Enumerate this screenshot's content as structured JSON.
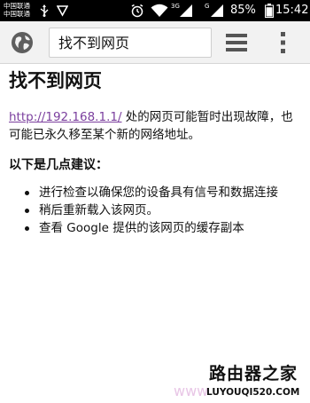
{
  "status_bar": {
    "carrier_1": "中国联通",
    "carrier_2": "中国联通",
    "network_label_1": "3G",
    "network_label_2": "G",
    "battery": "85%",
    "time": "15:42",
    "icons": [
      "usb-icon",
      "download-icon",
      "alarm-icon",
      "wifi-icon",
      "signal-icon",
      "battery-icon"
    ]
  },
  "toolbar": {
    "page_title": "找不到网页",
    "icons": [
      "globe-icon",
      "tab-switcher-icon",
      "overflow-menu-icon"
    ]
  },
  "page": {
    "heading": "找不到网页",
    "url": "http://192.168.1.1/",
    "message": " 处的网页可能暂时出现故障，也可能已永久移至某个新的网络地址。",
    "suggestions_heading": "以下是几点建议：",
    "suggestions": [
      "进行检查以确保您的设备具有信号和数据连接",
      "稍后重新载入该网页。",
      "查看 Google 提供的该网页的缓存副本"
    ]
  },
  "watermark": {
    "title": "路由器之家",
    "url": "LUYOUQI520.COM",
    "faint_text": "www"
  },
  "colors": {
    "status_bar_bg": "#000000",
    "toolbar_bg": "#f2f2f2",
    "link": "#7b3f9e",
    "text": "#111111"
  }
}
